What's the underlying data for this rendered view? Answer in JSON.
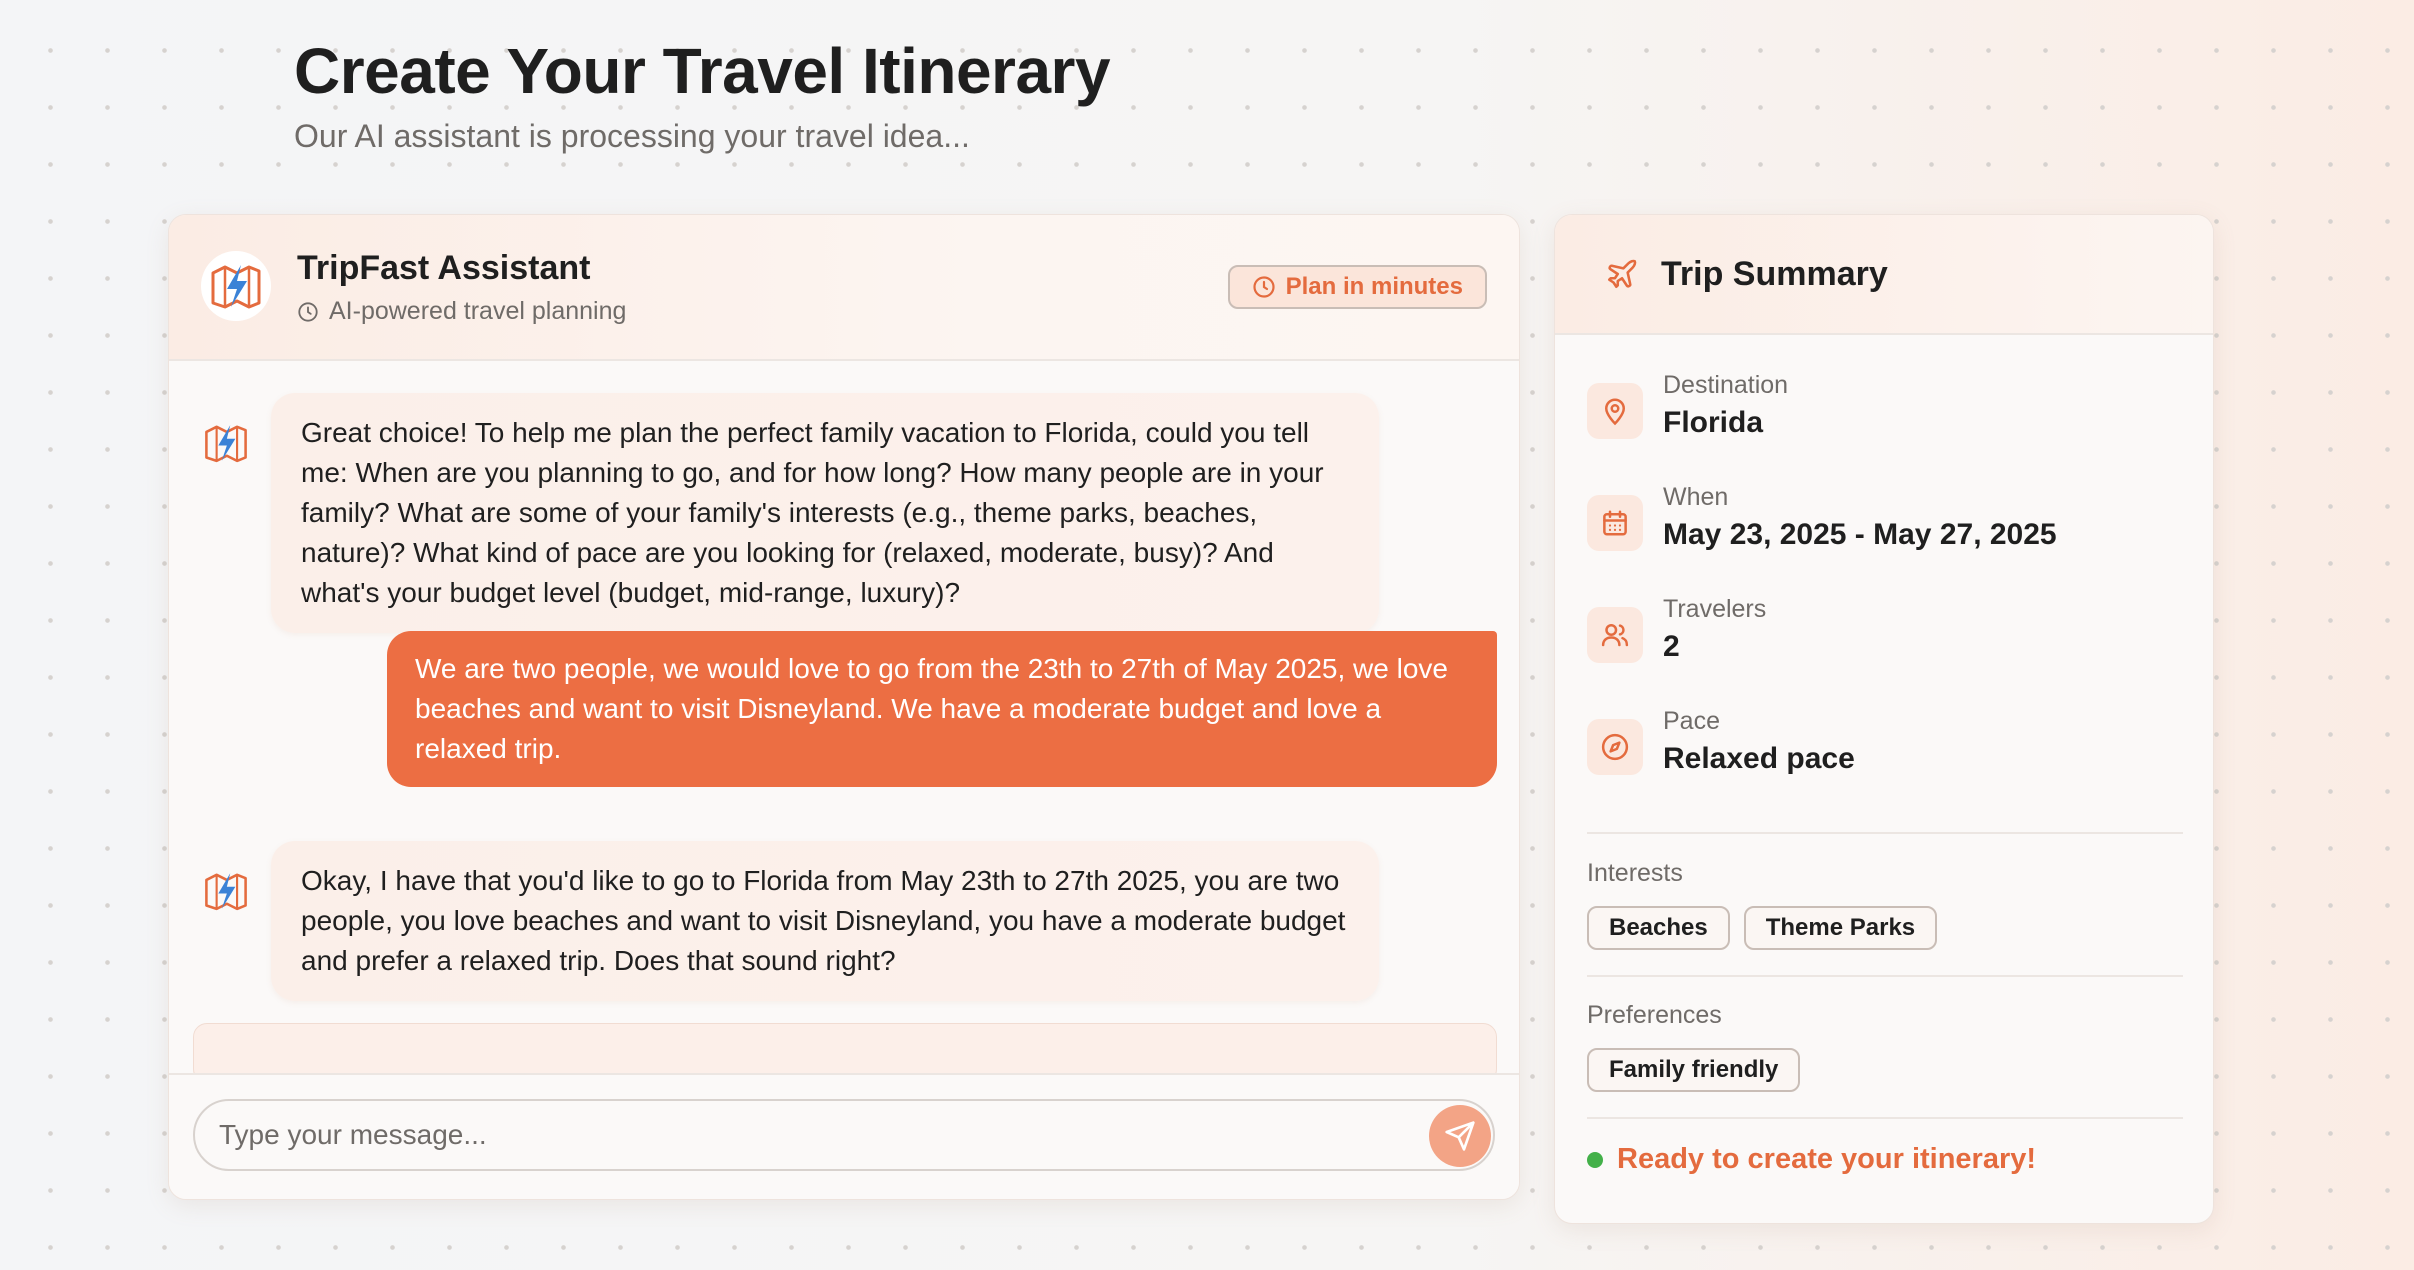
{
  "page": {
    "title": "Create Your Travel Itinerary",
    "subtitle": "Our AI assistant is processing your travel idea..."
  },
  "chat": {
    "assistant_name": "TripFast Assistant",
    "assistant_subtitle": "AI-powered travel planning",
    "badge": "Plan in minutes",
    "messages": [
      {
        "role": "assistant",
        "text": "Great choice! To help me plan the perfect family vacation to Florida, could you tell me: When are you planning to go, and for how long? How many people are in your family? What are some of your family's interests (e.g., theme parks, beaches, nature)? What kind of pace are you looking for (relaxed, moderate, busy)? And what's your budget level (budget, mid-range, luxury)?"
      },
      {
        "role": "user",
        "text": "We are two people, we would love to go from the 23th to 27th of May 2025, we love beaches and want to visit Disneyland. We have a moderate budget and love a relaxed trip."
      },
      {
        "role": "assistant",
        "text": "Okay, I have that you'd like to go to Florida from May 23th to 27th 2025, you are two people, you love beaches and want to visit Disneyland, you have a moderate budget and prefer a relaxed trip. Does that sound right?"
      }
    ],
    "input_placeholder": "Type your message..."
  },
  "summary": {
    "title": "Trip Summary",
    "destination": {
      "label": "Destination",
      "value": "Florida"
    },
    "when": {
      "label": "When",
      "value": "May 23, 2025 - May 27, 2025"
    },
    "travelers": {
      "label": "Travelers",
      "value": "2"
    },
    "pace": {
      "label": "Pace",
      "value": "Relaxed pace"
    },
    "interests_label": "Interests",
    "interests": [
      "Beaches",
      "Theme Parks"
    ],
    "preferences_label": "Preferences",
    "preferences": [
      "Family friendly"
    ],
    "ready_text": "Ready to create your itinerary!"
  },
  "colors": {
    "accent": "#ec6e43",
    "accent_text": "#e46b3e",
    "ready_dot": "#43b049",
    "icon_blue": "#3b82d6"
  },
  "icons": {
    "logo": "map-lightning-icon",
    "clock": "clock-icon",
    "send": "send-icon",
    "plane": "plane-icon",
    "destination": "map-pin-icon",
    "when": "calendar-icon",
    "travelers": "users-icon",
    "pace": "compass-icon"
  }
}
